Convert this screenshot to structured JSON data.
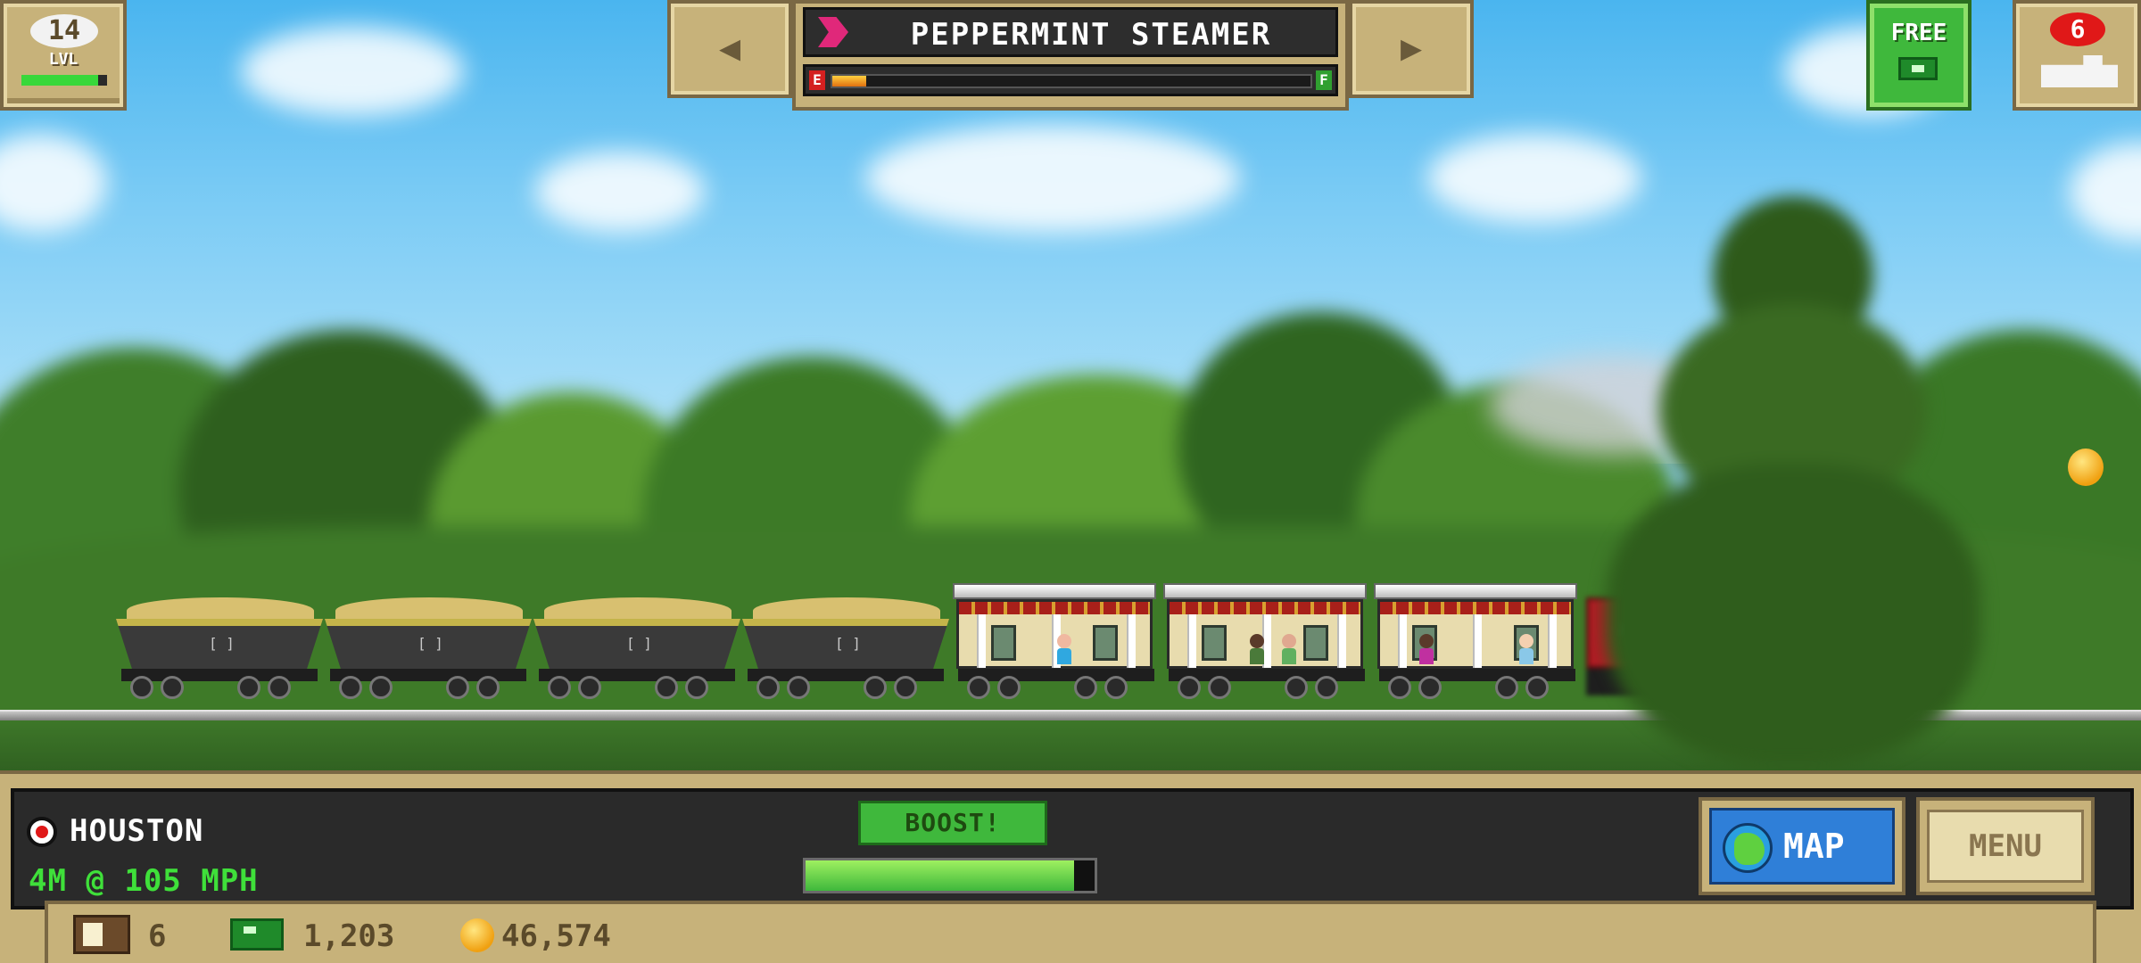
{
  "level": {
    "value": "14",
    "label": "LVL",
    "progress": 0.9
  },
  "train": {
    "name": "PEPPERMINT STEAMER",
    "fuel_empty_label": "E",
    "fuel_full_label": "F",
    "fuel_level": 0.07
  },
  "free_button": {
    "label": "FREE"
  },
  "trains_button": {
    "count": "6"
  },
  "route": {
    "station": "HOUSTON",
    "distance_speed": "4M @ 105 MPH"
  },
  "boost": {
    "label": "BOOST!",
    "meter": 0.93
  },
  "buttons": {
    "map": "MAP",
    "menu": "MENU"
  },
  "resources": {
    "crates": "6",
    "bucks": "1,203",
    "coins": "46,574"
  },
  "colors": {
    "accent_green": "#3fb83c",
    "hud_tan": "#c7b27a",
    "badge_red": "#e01818",
    "speed_green": "#3fe03a"
  },
  "icons": [
    "arrow-left-icon",
    "arrow-right-icon",
    "peppermint-icon",
    "cash-icon",
    "train-icon",
    "station-icon",
    "globe-icon",
    "crate-icon",
    "coin-icon"
  ]
}
